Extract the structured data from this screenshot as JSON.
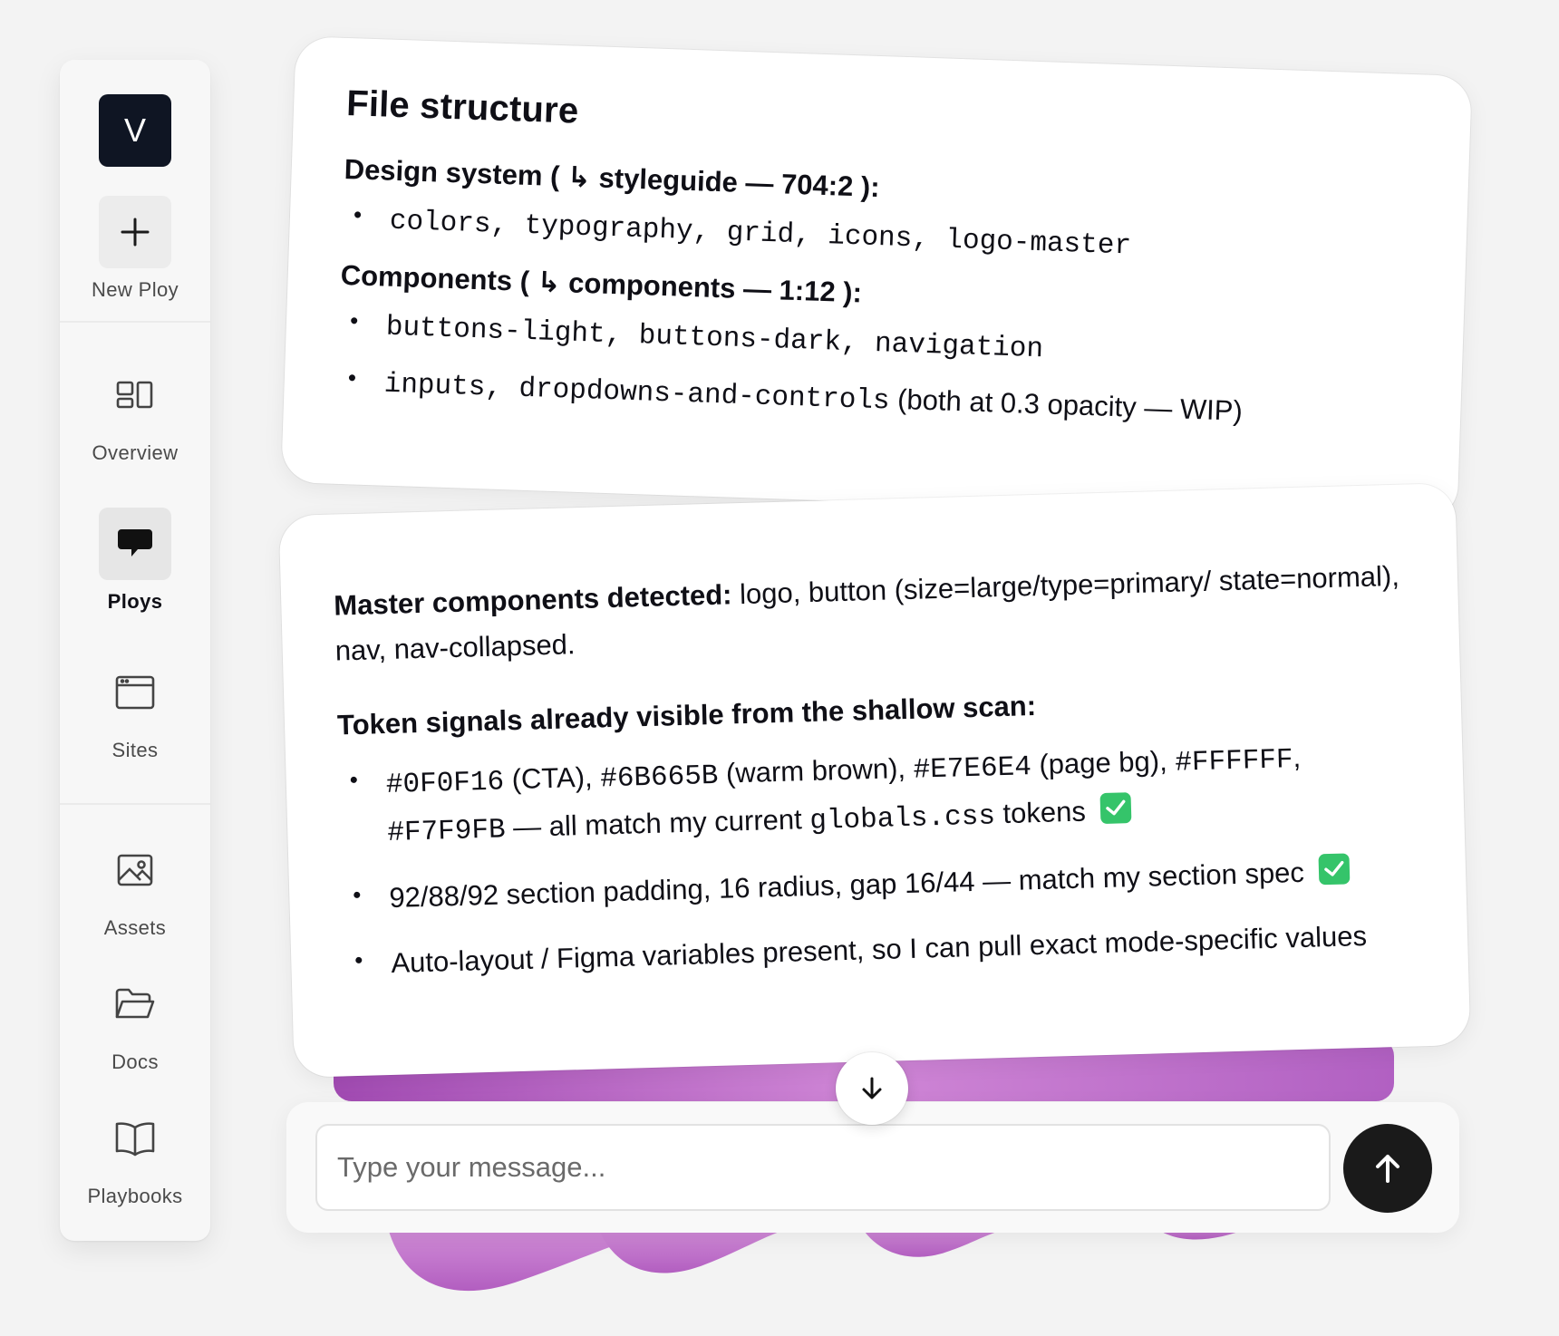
{
  "sidebar": {
    "logo_letter": "V",
    "new_button_label": "New Ploy",
    "items": [
      {
        "label": "Overview",
        "icon": "overview-icon"
      },
      {
        "label": "Ploys",
        "icon": "chat-bubble-icon",
        "active": true
      },
      {
        "label": "Sites",
        "icon": "browser-window-icon"
      },
      {
        "label": "Assets",
        "icon": "image-icon"
      },
      {
        "label": "Docs",
        "icon": "folder-icon"
      },
      {
        "label": "Playbooks",
        "icon": "book-icon"
      }
    ]
  },
  "card1": {
    "title": "File structure",
    "design_system": {
      "label": "Design system (",
      "arrow": "↳",
      "link": "styleguide — 704:2 ):",
      "items": "colors, typography, grid, icons, logo-master"
    },
    "components": {
      "label": "Components (",
      "arrow": "↳",
      "link": "components — 1:12 ):",
      "item1": "buttons-light, buttons-dark, navigation",
      "item2_mono": "inputs, dropdowns-and-controls",
      "item2_rest": " (both at 0.3 opacity — WIP)"
    }
  },
  "card2": {
    "master_label": "Master components detected:",
    "master_text": " logo, button (size=large/type=primary/ state=normal), nav, nav-collapsed.",
    "token_heading": "Token signals already visible from the shallow scan:",
    "token_b1_mono1": "#0F0F16",
    "token_b1_t1": " (CTA), ",
    "token_b1_mono2": "#6B665B",
    "token_b1_t2": " (warm brown), ",
    "token_b1_mono3": "#E7E6E4",
    "token_b1_t3": " (page bg), ",
    "token_b1_mono4": "#FFFFFF",
    "token_b1_t4": ", ",
    "token_b1_mono5": "#F7F9FB",
    "token_b1_t5": " — all match my current ",
    "token_b1_mono6": "globals.css",
    "token_b1_t6": " tokens",
    "token_b2": "92/88/92 section padding, 16 radius, gap 16/44 — match my section spec",
    "token_b3": "Auto-layout / Figma variables present, so I can pull exact mode-specific values"
  },
  "composer": {
    "placeholder": "Type your message..."
  },
  "colors": {
    "accent_dark": "#0f1523",
    "check_green": "#35c46a",
    "send_button": "#1a1a1a",
    "blob": "#c77dd0"
  }
}
